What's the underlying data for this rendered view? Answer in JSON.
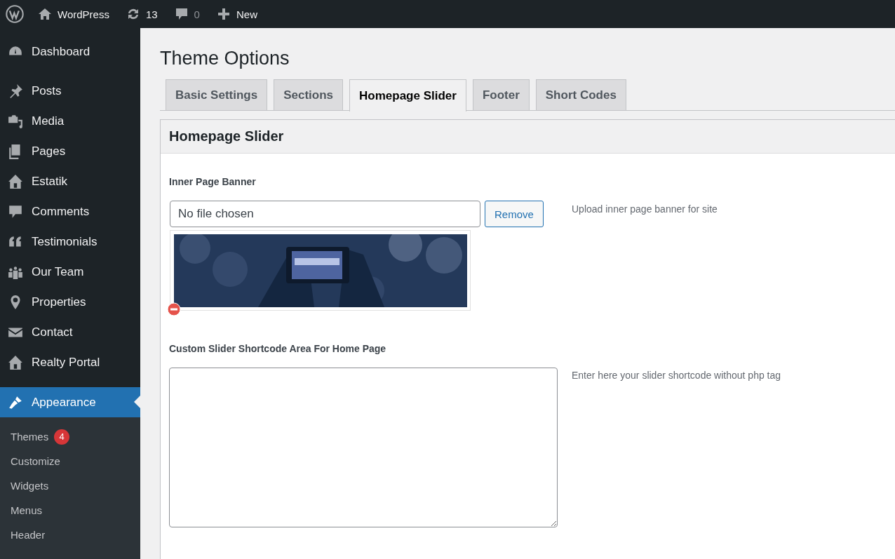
{
  "admin_bar": {
    "site": "WordPress",
    "updates": "13",
    "comments": "0",
    "new": "New"
  },
  "sidebar": {
    "items": [
      {
        "label": "Dashboard",
        "selected": false
      },
      {
        "label": "Posts",
        "selected": false
      },
      {
        "label": "Media",
        "selected": false
      },
      {
        "label": "Pages",
        "selected": false
      },
      {
        "label": "Estatik",
        "selected": false
      },
      {
        "label": "Comments",
        "selected": false
      },
      {
        "label": "Testimonials",
        "selected": false
      },
      {
        "label": "Our Team",
        "selected": false
      },
      {
        "label": "Properties",
        "selected": false
      },
      {
        "label": "Contact",
        "selected": false
      },
      {
        "label": "Realty Portal",
        "selected": false
      },
      {
        "label": "Appearance",
        "selected": true
      }
    ],
    "submenu": [
      {
        "label": "Themes",
        "badge": "4"
      },
      {
        "label": "Customize"
      },
      {
        "label": "Widgets"
      },
      {
        "label": "Menus"
      },
      {
        "label": "Header"
      }
    ]
  },
  "page_title": "Theme Options",
  "tabs": [
    {
      "label": "Basic Settings",
      "selected": false
    },
    {
      "label": "Sections",
      "selected": false
    },
    {
      "label": "Homepage Slider",
      "selected": true
    },
    {
      "label": "Footer",
      "selected": false
    },
    {
      "label": "Short Codes",
      "selected": false
    }
  ],
  "panel": {
    "title": "Homepage Slider",
    "fields": [
      {
        "kind": "upload",
        "label": "Inner Page Banner",
        "value": "No file chosen",
        "button": "Remove",
        "description": "Upload inner page banner for site"
      },
      {
        "kind": "textarea",
        "label": "Custom Slider Shortcode Area For Home Page",
        "description": "Enter here your slider shortcode without php tag"
      }
    ]
  }
}
